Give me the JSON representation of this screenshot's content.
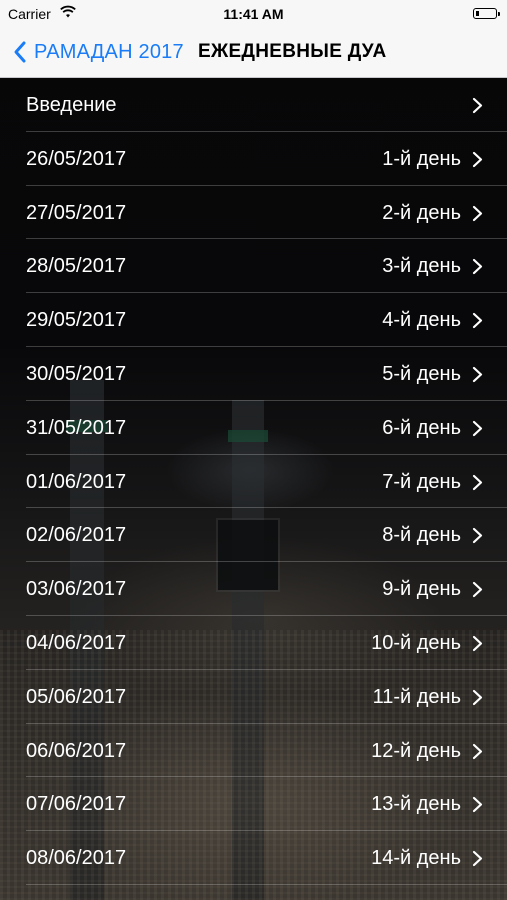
{
  "status_bar": {
    "carrier": "Carrier",
    "time": "11:41 AM",
    "wifi_icon": "wifi-icon",
    "battery_icon": "battery-icon"
  },
  "nav": {
    "back_label": "РАМАДАН 2017",
    "title": "ЕЖЕДНЕВНЫЕ ДУА",
    "back_icon": "chevron-left-icon",
    "accent_color": "#1a7cf6"
  },
  "rows": [
    {
      "left": "Введение",
      "right": ""
    },
    {
      "left": "26/05/2017",
      "right": "1-й день"
    },
    {
      "left": "27/05/2017",
      "right": "2-й день"
    },
    {
      "left": "28/05/2017",
      "right": "3-й день"
    },
    {
      "left": "29/05/2017",
      "right": "4-й день"
    },
    {
      "left": "30/05/2017",
      "right": "5-й день"
    },
    {
      "left": "31/05/2017",
      "right": "6-й день"
    },
    {
      "left": "01/06/2017",
      "right": "7-й день"
    },
    {
      "left": "02/06/2017",
      "right": "8-й день"
    },
    {
      "left": "03/06/2017",
      "right": "9-й день"
    },
    {
      "left": "04/06/2017",
      "right": "10-й день"
    },
    {
      "left": "05/06/2017",
      "right": "11-й день"
    },
    {
      "left": "06/06/2017",
      "right": "12-й день"
    },
    {
      "left": "07/06/2017",
      "right": "13-й день"
    },
    {
      "left": "08/06/2017",
      "right": "14-й день"
    }
  ]
}
